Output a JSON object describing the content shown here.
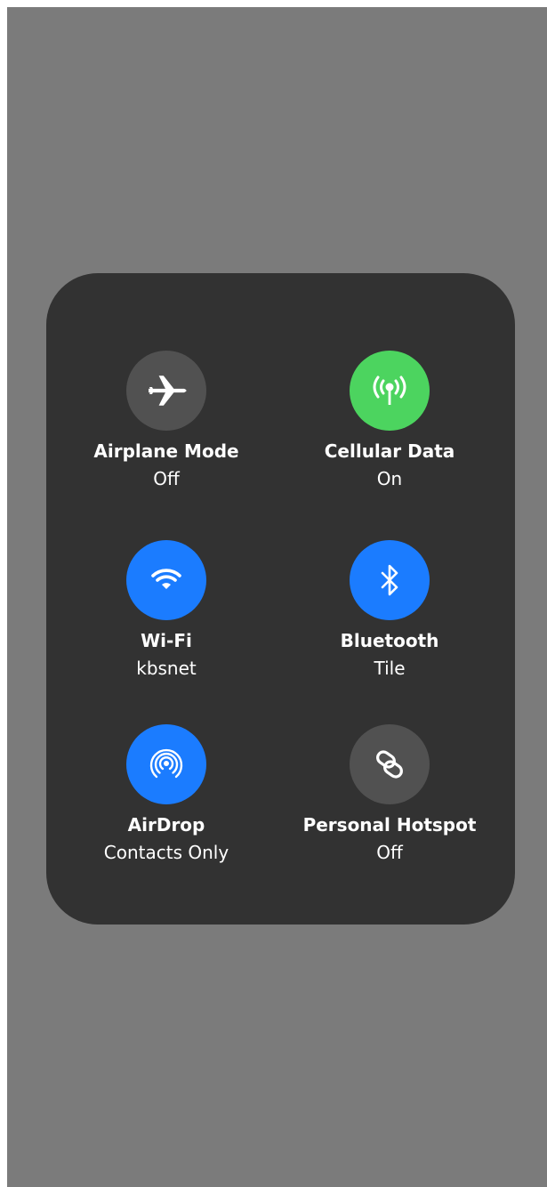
{
  "tiles": {
    "airplane": {
      "label": "Airplane Mode",
      "status": "Off",
      "icon": "airplane-icon",
      "active": false
    },
    "cellular": {
      "label": "Cellular Data",
      "status": "On",
      "icon": "cellular-antenna-icon",
      "active": true
    },
    "wifi": {
      "label": "Wi-Fi",
      "status": "kbsnet",
      "icon": "wifi-icon",
      "active": true
    },
    "bluetooth": {
      "label": "Bluetooth",
      "status": "Tile",
      "icon": "bluetooth-icon",
      "active": true
    },
    "airdrop": {
      "label": "AirDrop",
      "status": "Contacts Only",
      "icon": "airdrop-icon",
      "active": true
    },
    "hotspot": {
      "label": "Personal Hotspot",
      "status": "Off",
      "icon": "link-icon",
      "active": false
    }
  },
  "colors": {
    "background": "#7b7b7b",
    "panel": "#323232",
    "inactive": "#515151",
    "green": "#4cd45f",
    "blue": "#1b7cff",
    "text": "#ffffff"
  }
}
